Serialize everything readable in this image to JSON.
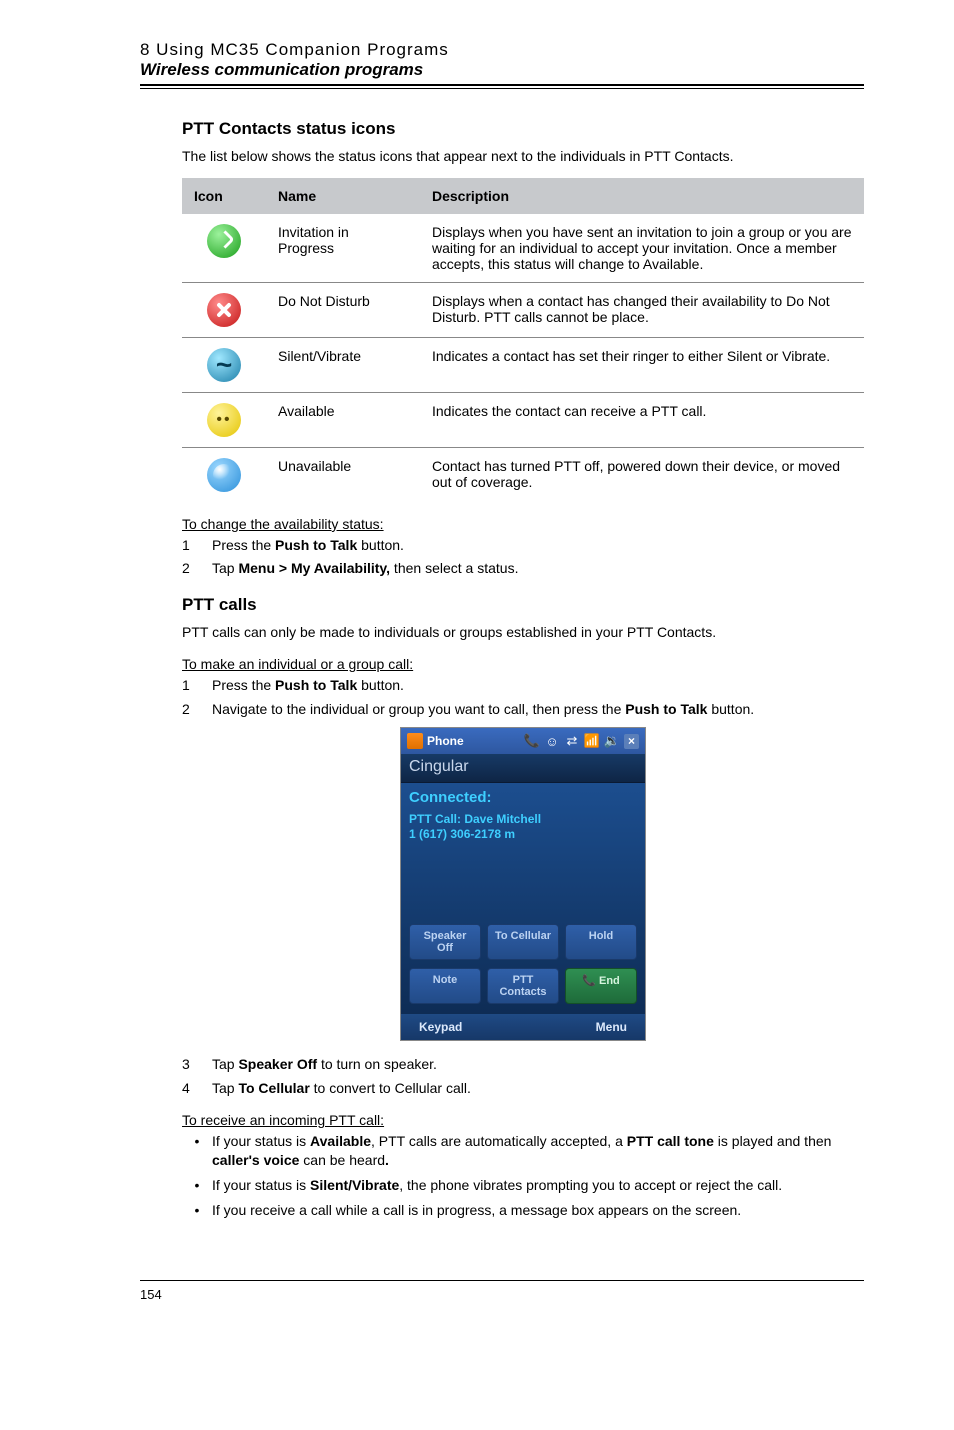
{
  "header": {
    "chapter": "8 Using MC35 Companion Programs",
    "section": "Wireless communication programs"
  },
  "ptt_icons": {
    "heading": "PTT Contacts status icons",
    "intro": "The list below shows the status icons that appear next to the individuals in PTT Contacts.",
    "cols": {
      "icon": "Icon",
      "name": "Name",
      "desc": "Description"
    },
    "rows": [
      {
        "name": "Invitation in Progress",
        "desc": "Displays when you have sent an invitation to join a group or you are waiting for an individual to accept your invitation. Once a member accepts, this status will change to Available."
      },
      {
        "name": "Do Not Disturb",
        "desc": "Displays when a contact has changed their availability to Do Not Disturb. PTT calls cannot be place."
      },
      {
        "name": "Silent/Vibrate",
        "desc": "Indicates a contact has set their ringer to either Silent or Vibrate."
      },
      {
        "name": "Available",
        "desc": "Indicates the contact can receive a PTT call."
      },
      {
        "name": "Unavailable",
        "desc": "Contact has turned PTT off, powered down their device, or moved out of coverage."
      }
    ]
  },
  "avail": {
    "task": "To change the availability status:",
    "step1_pre": "Press the ",
    "step1_bold": "Push to Talk",
    "step1_post": " button.",
    "step2_pre": "Tap ",
    "step2_bold": "Menu > My Availability,",
    "step2_post": " then select a status."
  },
  "calls": {
    "heading": "PTT calls",
    "intro": "PTT calls can only be made to individuals or groups established in your PTT Contacts.",
    "task_make": "To make an individual or a group call:",
    "make1_pre": "Press the ",
    "make1_bold": "Push to Talk",
    "make1_post": " button.",
    "make2_pre": "Navigate to the individual or group you want to call, then press the ",
    "make2_bold": "Push to Talk",
    "make2_post": " button.",
    "make3_pre": "Tap ",
    "make3_bold": "Speaker Off",
    "make3_post": " to turn on speaker.",
    "make4_pre": "Tap ",
    "make4_bold": "To Cellular",
    "make4_post": " to convert to Cellular call.",
    "task_recv": "To receive an incoming PTT call:",
    "recv1_a": "If your status is ",
    "recv1_b": "Available",
    "recv1_c": ", PTT calls are automatically accepted, a ",
    "recv1_d": "PTT call tone",
    "recv1_e": " is played and then ",
    "recv1_f": "caller's voice",
    "recv1_g": " can be heard",
    "recv1_h": ".",
    "recv2_a": "If your status is ",
    "recv2_b": "Silent/Vibrate",
    "recv2_c": ", the phone vibrates prompting you to accept or reject the call.",
    "recv3": "If you receive a call while a call is in progress, a message box appears on the screen."
  },
  "shot": {
    "title": "Phone",
    "brand": "Cingular",
    "connected": "Connected:",
    "call1": "PTT Call: Dave Mitchell",
    "call2": "1 (617) 306-2178 m",
    "btn_speaker": "Speaker Off",
    "btn_cell": "To Cellular",
    "btn_hold": "Hold",
    "btn_note": "Note",
    "btn_contacts": "PTT Contacts",
    "btn_end": "End",
    "menu_left": "Keypad",
    "menu_right": "Menu"
  },
  "pagenum": "154"
}
